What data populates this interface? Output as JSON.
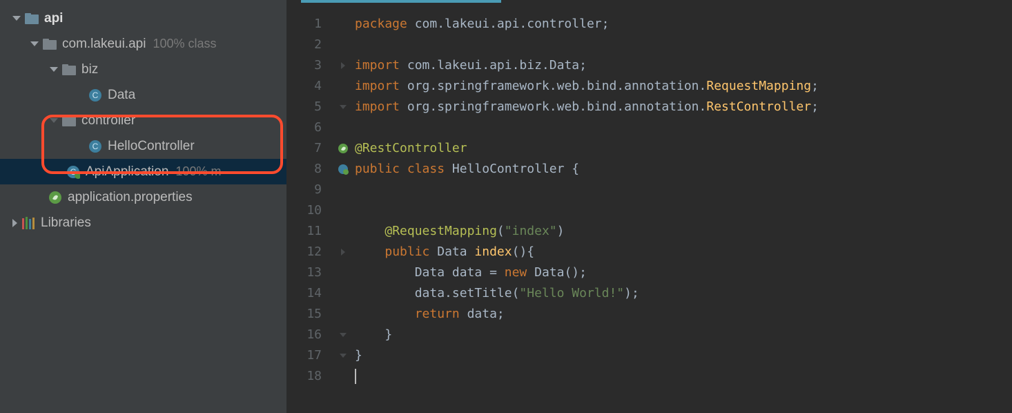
{
  "tree": {
    "api": "api",
    "pkg": "com.lakeui.api",
    "pkg_hint": "100% class",
    "biz": "biz",
    "data": "Data",
    "controller": "controller",
    "hello": "HelloController",
    "apiapp": "ApiApplication",
    "apiapp_hint": "100% m",
    "appprops": "application.properties",
    "libraries": "Libraries"
  },
  "code": {
    "lines": [
      "1",
      "2",
      "3",
      "4",
      "5",
      "6",
      "7",
      "8",
      "9",
      "10",
      "11",
      "12",
      "13",
      "14",
      "15",
      "16",
      "17",
      "18"
    ],
    "l1": {
      "kw": "package",
      "rest": " com.lakeui.api.controller;"
    },
    "l3": {
      "kw": "import",
      "rest": " com.lakeui.api.biz.Data;"
    },
    "l4": {
      "kw": "import",
      "mid": " org.springframework.web.bind.annotation.",
      "cls": "RequestMapping",
      "end": ";"
    },
    "l5": {
      "kw": "import",
      "mid": " org.springframework.web.bind.annotation.",
      "cls": "RestController",
      "end": ";"
    },
    "l7": {
      "ann": "@RestController"
    },
    "l8": {
      "kw1": "public",
      "kw2": " class",
      "id": " HelloController ",
      "br": "{"
    },
    "l11": {
      "ann": "@RequestMapping",
      "p1": "(",
      "str": "\"index\"",
      "p2": ")"
    },
    "l12": {
      "kw": "public",
      "typ": " Data ",
      "meth": "index",
      "rest": "(){"
    },
    "l13": {
      "a": "Data data = ",
      "kw": "new",
      "b": " Data();"
    },
    "l14": {
      "a": "data.setTitle(",
      "str": "\"Hello World!\"",
      "b": ");"
    },
    "l15": {
      "kw": "return",
      "rest": " data;"
    },
    "l16": {
      "br": "}"
    },
    "l17": {
      "br": "}"
    }
  }
}
